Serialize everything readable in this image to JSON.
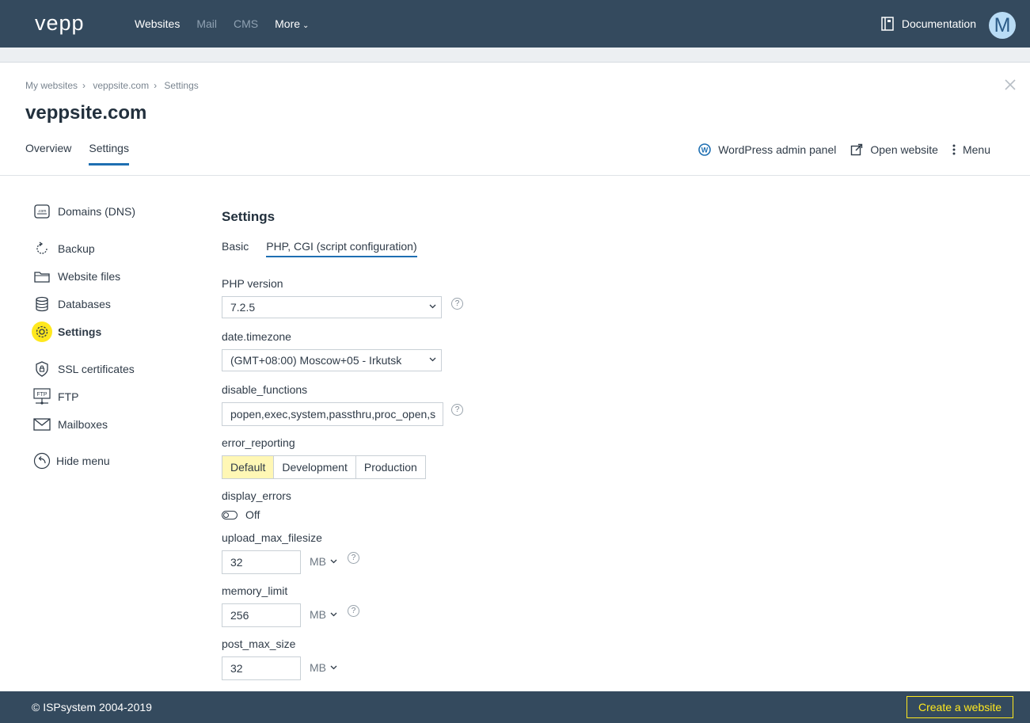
{
  "topbar": {
    "logo": "vepp",
    "nav": [
      {
        "label": "Websites",
        "active": true
      },
      {
        "label": "Mail",
        "active": false
      },
      {
        "label": "CMS",
        "active": false
      },
      {
        "label": "More",
        "active": true
      }
    ],
    "documentation_label": "Documentation",
    "avatar_initial": "M"
  },
  "breadcrumb": [
    "My websites",
    "veppsite.com",
    "Settings"
  ],
  "page_title": "veppsite.com",
  "tabs": [
    {
      "label": "Overview",
      "active": false
    },
    {
      "label": "Settings",
      "active": true
    }
  ],
  "actions": {
    "wordpress_label": "WordPress admin panel",
    "open_website_label": "Open website",
    "menu_label": "Menu"
  },
  "sidemenu": {
    "items": [
      {
        "label": "Domains (DNS)",
        "icon": "domains-icon",
        "active": false
      },
      {
        "label": "Backup",
        "icon": "backup-icon",
        "active": false
      },
      {
        "label": "Website files",
        "icon": "folder-icon",
        "active": false
      },
      {
        "label": "Databases",
        "icon": "database-icon",
        "active": false
      },
      {
        "label": "Settings",
        "icon": "gear-icon",
        "active": true
      },
      {
        "label": "SSL certificates",
        "icon": "shield-lock-icon",
        "active": false
      },
      {
        "label": "FTP",
        "icon": "ftp-icon",
        "active": false
      },
      {
        "label": "Mailboxes",
        "icon": "envelope-icon",
        "active": false
      }
    ],
    "hide_menu_label": "Hide menu"
  },
  "settings": {
    "heading": "Settings",
    "subtabs": [
      {
        "label": "Basic",
        "active": false
      },
      {
        "label": "PHP, CGI (script configuration)",
        "active": true
      }
    ],
    "php_version": {
      "label": "PHP version",
      "value": "7.2.5"
    },
    "timezone": {
      "label": "date.timezone",
      "value": "(GMT+08:00) Moscow+05 - Irkutsk"
    },
    "disable_functions": {
      "label": "disable_functions",
      "value": "popen,exec,system,passthru,proc_open,s"
    },
    "error_reporting": {
      "label": "error_reporting",
      "options": [
        "Default",
        "Development",
        "Production"
      ],
      "selected": "Default"
    },
    "display_errors": {
      "label": "display_errors",
      "value": "Off"
    },
    "upload_max_filesize": {
      "label": "upload_max_filesize",
      "value": "32",
      "unit": "MB"
    },
    "memory_limit": {
      "label": "memory_limit",
      "value": "256",
      "unit": "MB"
    },
    "post_max_size": {
      "label": "post_max_size",
      "value": "32",
      "unit": "MB"
    },
    "help_glyph": "?"
  },
  "footer": {
    "copyright": "© ISPsystem 2004-2019",
    "create_button": "Create a website"
  },
  "colors": {
    "topbar_bg": "#344a5e",
    "accent_blue": "#1e6fb2",
    "highlight_yellow": "#ffe81e",
    "selected_segment": "#fff7b5"
  }
}
